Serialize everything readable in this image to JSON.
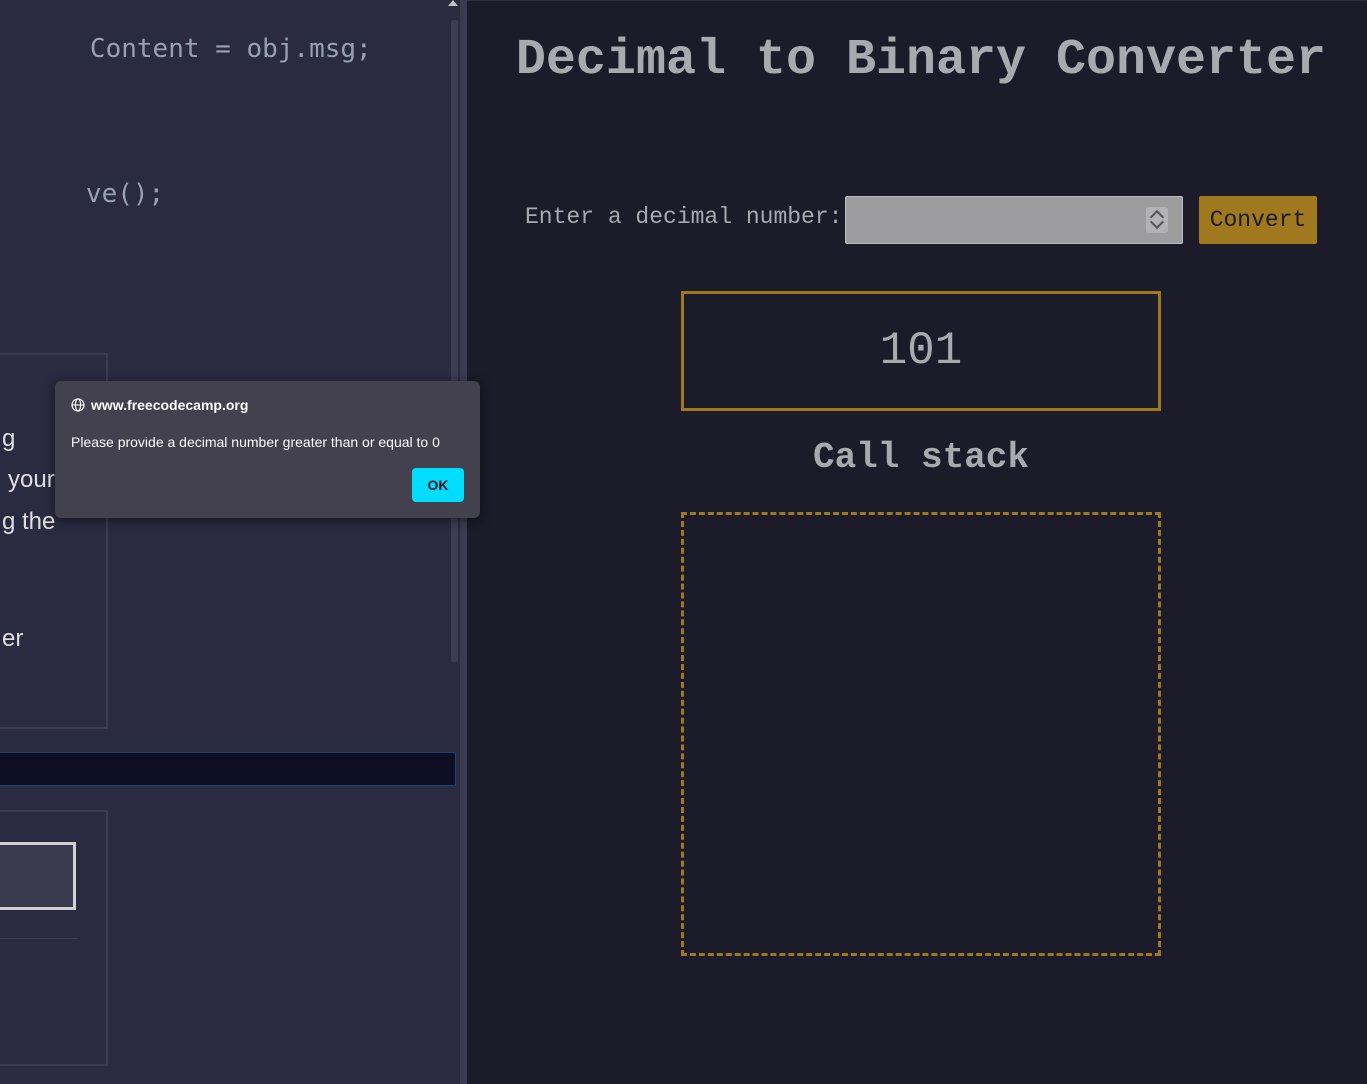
{
  "editor": {
    "code_lines": [
      {
        "text": "Content = obj.msg;"
      },
      {
        "text": "ve();"
      }
    ],
    "panel_1_fragments": [
      "g",
      "your",
      "g the",
      "er"
    ]
  },
  "preview": {
    "title": "Decimal to Binary Converter",
    "input_label": "Enter a decimal number:",
    "input_value": "",
    "convert_label": "Convert",
    "result": "101",
    "call_stack_heading": "Call stack"
  },
  "alert": {
    "origin": "www.freecodecamp.org",
    "message": "Please provide a decimal number greater than or equal to 0",
    "ok_label": "OK"
  },
  "colors": {
    "accent_gold": "#a0791f",
    "ok_button": "#00ddff",
    "preview_bg": "#1b1b29",
    "editor_bg": "#2a2a40"
  },
  "icons": {
    "alert_origin": "globe-icon",
    "number_spinner": "spinner-arrows-icon",
    "scroll_up": "scroll-up-arrow-icon"
  }
}
